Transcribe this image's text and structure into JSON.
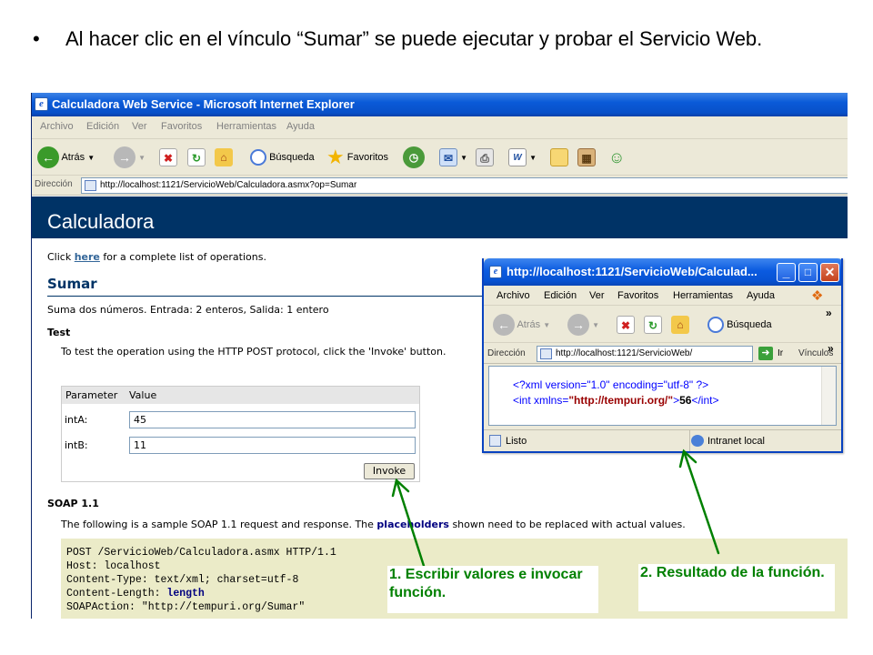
{
  "slide": {
    "bullet_char": "•",
    "bullet_text": "Al hacer clic en el vínculo “Sumar” se puede ejecutar y probar el Servicio Web."
  },
  "ie_main": {
    "title": "Calculadora Web Service - Microsoft Internet Explorer",
    "menu": [
      "Archivo",
      "Edición",
      "Ver",
      "Favoritos",
      "Herramientas",
      "Ayuda"
    ],
    "toolbar": {
      "back": "Atrás",
      "search": "Búsqueda",
      "favorites": "Favoritos"
    },
    "address_label": "Dirección",
    "address_url": "http://localhost:1121/ServicioWeb/Calculadora.asmx?op=Sumar"
  },
  "page": {
    "banner_title": "Calculadora",
    "click_prefix": "Click",
    "click_link": "here",
    "click_suffix": "for a complete list of operations.",
    "operation_name": "Sumar",
    "operation_desc": "Suma dos números. Entrada: 2 enteros, Salida: 1 entero",
    "test_heading": "Test",
    "test_instruction": "To test the operation using the HTTP POST protocol, click the 'Invoke' button.",
    "param_header": "Parameter",
    "value_header": "Value",
    "params": [
      {
        "name": "intA:",
        "value": "45"
      },
      {
        "name": "intB:",
        "value": "11"
      }
    ],
    "invoke_label": "Invoke",
    "soap_heading": "SOAP 1.1",
    "soap_text_before": "The following is a sample SOAP 1.1 request and response. The",
    "soap_placeholders": "placeholders",
    "soap_text_after": "shown need to be replaced with actual values.",
    "code_lines": [
      "POST /ServicioWeb/Calculadora.asmx HTTP/1.1",
      "Host: localhost",
      "Content-Type: text/xml; charset=utf-8",
      "Content-Length: ",
      "SOAPAction: \"http://tempuri.org/Sumar\""
    ],
    "code_length_placeholder": "length"
  },
  "popup": {
    "title": "http://localhost:1121/ServicioWeb/Calculad...",
    "menu": [
      "Archivo",
      "Edición",
      "Ver",
      "Favoritos",
      "Herramientas",
      "Ayuda"
    ],
    "toolbar": {
      "back": "Atrás",
      "search": "Búsqueda"
    },
    "address_label": "Dirección",
    "address_url": "http://localhost:1121/ServicioWeb/",
    "go_label": "Ir",
    "links_label": "Vínculos",
    "xml_decl": "<?xml version=\"1.0\" encoding=\"utf-8\" ?>",
    "xml_open": "<int xmlns=",
    "xml_ns": "\"http://tempuri.org/\"",
    "xml_gt": ">",
    "xml_value": "56",
    "xml_close": "</int>",
    "status_left": "Listo",
    "status_zone": "Intranet local"
  },
  "annotations": {
    "step1": "1. Escribir valores e invocar función.",
    "step2": "2. Resultado de la función."
  },
  "colors": {
    "banner": "#003366",
    "annotation": "#008000",
    "code_bg": "#ebebc8",
    "xp_blue": "#0a5ad8"
  }
}
